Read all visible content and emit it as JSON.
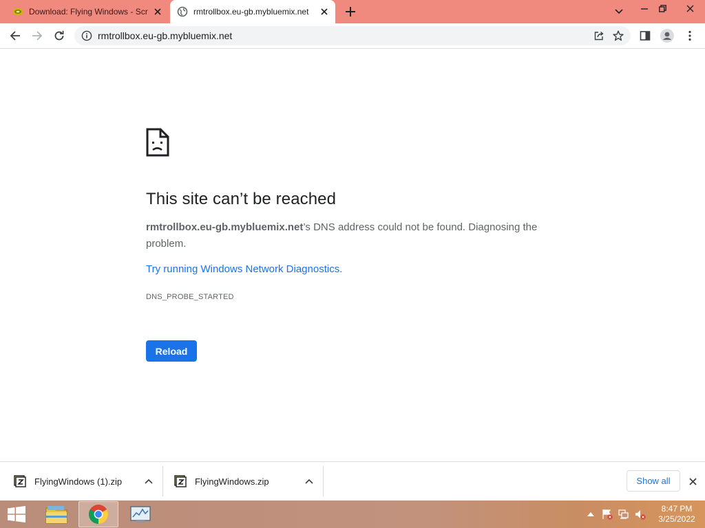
{
  "tabs": [
    {
      "title": "Download: Flying Windows - Scr",
      "active": false,
      "favicon": "download-site-icon"
    },
    {
      "title": "rmtrollbox.eu-gb.mybluemix.net",
      "active": true,
      "favicon": "globe-icon"
    }
  ],
  "toolbar": {
    "url": "rmtrollbox.eu-gb.mybluemix.net"
  },
  "error_page": {
    "title": "This site can’t be reached",
    "host": "rmtrollbox.eu-gb.mybluemix.net",
    "message": "’s DNS address could not be found. Diagnosing the problem.",
    "diagnostics_link": "Try running Windows Network Diagnostics.",
    "error_code": "DNS_PROBE_STARTED",
    "reload_label": "Reload"
  },
  "downloads": {
    "items": [
      {
        "filename": "FlyingWindows (1).zip"
      },
      {
        "filename": "FlyingWindows.zip"
      }
    ],
    "show_all_label": "Show all"
  },
  "taskbar": {
    "time": "8:47 PM",
    "date": "3/25/2022"
  },
  "colors": {
    "tab_strip": "#f08a7f",
    "accent_blue": "#1a73e8",
    "taskbar": "#c2927d"
  }
}
